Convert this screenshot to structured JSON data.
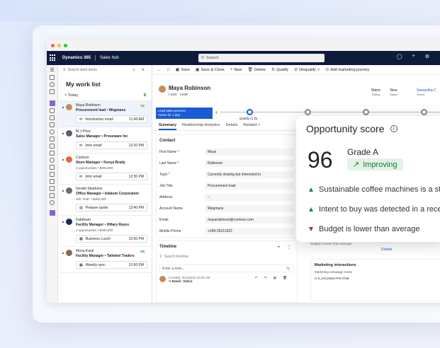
{
  "appbar": {
    "app_name": "Dynamics 365",
    "module": "Sales hub",
    "search_placeholder": "Search"
  },
  "worklist": {
    "search_placeholder": "Search work items",
    "title": "My work list",
    "group": "Today",
    "group_count": "8",
    "items": [
      {
        "name": "Maya Robinson",
        "role": "Procurement lead • Wegmans",
        "sub": "",
        "badge": "91",
        "task": "Introduction email",
        "time": "11:40 AM"
      },
      {
        "name": "M J Price",
        "role": "Sales Manager • Proseware Inc",
        "sub": "",
        "badge": "",
        "task": "Intro email",
        "time": "12:20 PM"
      },
      {
        "name": "Contoso",
        "role": "Store Manager • Kenya Brady",
        "sub": "3 opportunities • $300,000",
        "badge": "",
        "task": "Intro email",
        "time": "12:30 PM"
      },
      {
        "name": "Gerald Stephens",
        "role": "Office Manager • Adatum Corporation",
        "sub": "200 \"Sub\" • $300,000",
        "badge": "",
        "task": "Prepare quote",
        "time": "12:40 PM"
      },
      {
        "name": "Fabrikam",
        "role": "Facility Manager • Hillary Reyes",
        "sub": "2 opportunities • $300,000",
        "badge": "",
        "task": "Business Lunch",
        "time": "12:50 PM"
      },
      {
        "name": "Mona Kane",
        "role": "Facility Manager • Tailwind Traders",
        "sub": "",
        "badge": "91",
        "task": "Weekly sync",
        "time": "12:50 PM"
      }
    ]
  },
  "commands": [
    "Save",
    "Save & Close",
    "New",
    "Delete",
    "Qualify",
    "Disqualify",
    "Add marketing journey"
  ],
  "record": {
    "name": "Maya Robinson",
    "type": "Lead · Lead",
    "rating_value": "Warm",
    "rating_label": "Rating",
    "status_value": "New",
    "status_label": "Status",
    "owner_value": "Samantha C",
    "owner_label": "Owner"
  },
  "bpf": {
    "process_name": "Lead sales process",
    "process_sub": "Active for 1 day",
    "current_stage": "Qualify (1 D)"
  },
  "tabs": [
    "Summary",
    "Realtionship Analytics",
    "Details",
    "Related"
  ],
  "contact": {
    "title": "Contact",
    "fields": [
      {
        "label": "First Name *",
        "value": "Maya"
      },
      {
        "label": "Last Name *",
        "value": "Robinson"
      },
      {
        "label": "Topic *",
        "value": "Currently sharing but interested in"
      },
      {
        "label": "Job Title",
        "value": "Procurement lead"
      },
      {
        "label": "Address",
        "value": "--"
      },
      {
        "label": "Account Name",
        "value": "Wegmans"
      },
      {
        "label": "Email",
        "value": "mayarobinson@contoso.com"
      },
      {
        "label": "Mobile Phone",
        "value": "+349-35211922"
      }
    ]
  },
  "timeline": {
    "title": "Timeline",
    "search_placeholder": "Search timeline",
    "note_placeholder": "Enter a note...",
    "item_created": "Created: 3/11/2022 10:55 AM",
    "item_type": "Email",
    "item_status": "Status"
  },
  "right": {
    "reason_text": "Budget is lower than average",
    "details_link": "Details",
    "mi_title": "Marketing interactions",
    "mi_label": "Marketing campaign name",
    "mi_value": "U.S_InContact Pre-Chat"
  },
  "opportunity": {
    "title": "Opportunity score",
    "score": "96",
    "grade": "Grade A",
    "trend": "Improving",
    "insights": [
      {
        "dir": "up",
        "text": "Sustainable coffee machines is a str"
      },
      {
        "dir": "up",
        "text": "Intent to buy was detected in a rece"
      },
      {
        "dir": "down",
        "text": "Budget is lower than average"
      }
    ]
  },
  "colors": {
    "accent": "#1a5bd6",
    "appbar": "#0f1b3b",
    "positive": "#1f8a3a",
    "negative": "#c4262e"
  }
}
